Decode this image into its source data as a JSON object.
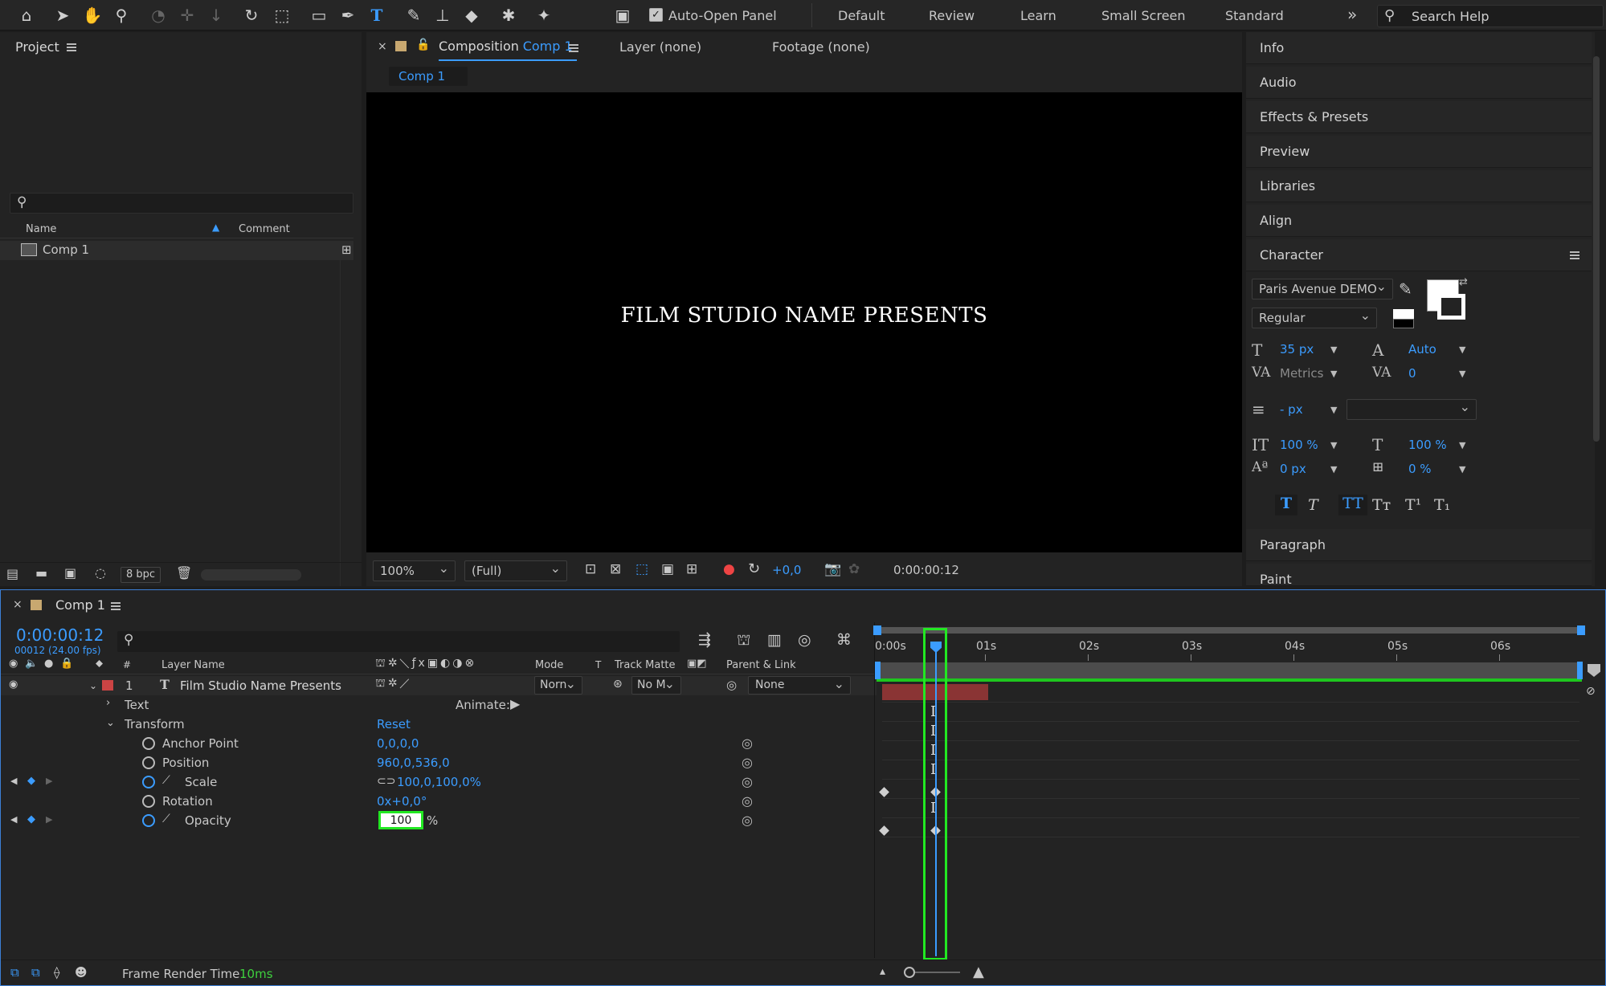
{
  "toolbar": {
    "auto_open_panel": "Auto-Open Panel",
    "workspaces": [
      "Default",
      "Review",
      "Learn",
      "Small Screen",
      "Standard"
    ],
    "more": "»",
    "search_placeholder": "Search Help"
  },
  "project": {
    "title": "Project",
    "col_name": "Name",
    "col_comment": "Comment",
    "item": "Comp 1",
    "bpc": "8 bpc"
  },
  "viewer": {
    "tab_composition": "Composition",
    "tab_comp_name": "Comp 1",
    "tab_layer": "Layer (none)",
    "tab_footage": "Footage (none)",
    "comp_tab": "Comp 1",
    "canvas_text": "FILM STUDIO NAME PRESENTS",
    "zoom": "100%",
    "resolution": "(Full)",
    "exposure": "+0,0",
    "timecode": "0:00:00:12"
  },
  "right_panel": {
    "sections": [
      "Info",
      "Audio",
      "Effects & Presets",
      "Preview",
      "Libraries",
      "Align"
    ],
    "character_title": "Character",
    "font": "Paris Avenue DEMO",
    "style": "Regular",
    "font_size": "35 px",
    "leading": "Auto",
    "kerning": "Metrics",
    "tracking": "0",
    "stroke_width": "- px",
    "vert_scale": "100 %",
    "horiz_scale": "100 %",
    "baseline": "0 px",
    "tsume": "0 %",
    "paragraph_title": "Paragraph",
    "paint_title": "Paint"
  },
  "timeline": {
    "title": "Comp 1",
    "timecode": "0:00:00:12",
    "fps_info": "00012 (24.00 fps)",
    "headers": {
      "num": "#",
      "layer_name": "Layer Name",
      "mode": "Mode",
      "t": "T",
      "track_matte": "Track Matte",
      "parent": "Parent & Link"
    },
    "layer": {
      "index": "1",
      "name": "Film Studio Name Presents",
      "mode": "Norn",
      "matte": "No M",
      "parent": "None"
    },
    "text_group": "Text",
    "animate": "Animate:",
    "transform": "Transform",
    "reset": "Reset",
    "props": [
      {
        "name": "Anchor Point",
        "value": "0,0,0,0"
      },
      {
        "name": "Position",
        "value": "960,0,536,0"
      },
      {
        "name": "Scale",
        "value": "100,0,100,0%"
      },
      {
        "name": "Rotation",
        "value": "0x+0,0°"
      },
      {
        "name": "Opacity",
        "value": "100",
        "unit": "%"
      }
    ],
    "ruler": [
      "0:00s",
      "01s",
      "02s",
      "03s",
      "04s",
      "05s",
      "06s"
    ],
    "footer_label": "Frame Render Time",
    "footer_value": "10ms"
  }
}
